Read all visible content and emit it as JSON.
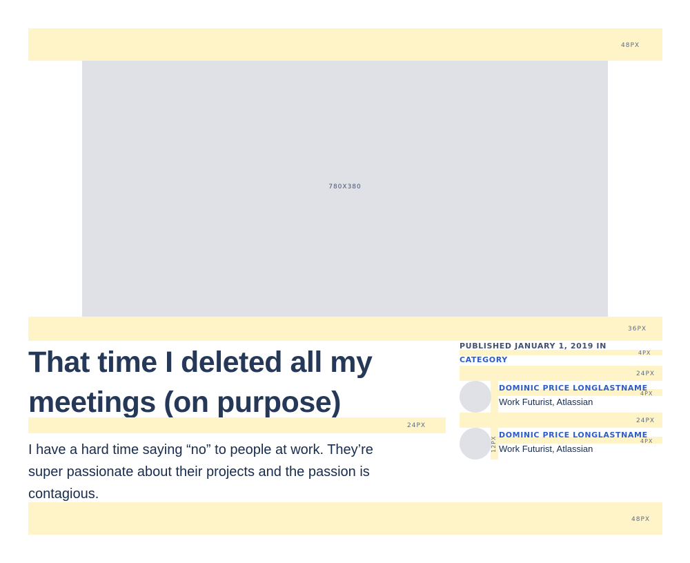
{
  "spacing": {
    "top": "48PX",
    "below_hero": "36PX",
    "below_title": "24PX",
    "meta_gap": "4PX",
    "below_meta": "24PX",
    "author_name_gap_1": "4PX",
    "between_authors": "24PX",
    "author_name_gap_2": "4PX",
    "avatar_gap": "12PX",
    "bottom": "48PX"
  },
  "hero": {
    "size_label": "780X380"
  },
  "article": {
    "title": "That time I deleted all my meetings (on purpose)",
    "intro": "I have a hard time saying “no” to people at work. They’re super passionate about their projects and the passion is contagious."
  },
  "meta": {
    "published": "PUBLISHED JANUARY 1, 2019 IN",
    "category": "CATEGORY"
  },
  "authors": [
    {
      "name": "DOMINIC PRICE LONGLASTNAME",
      "role": "Work Futurist, Atlassian"
    },
    {
      "name": "DOMINIC PRICE LONGLASTNAME",
      "role": "Work Futurist, Atlassian"
    }
  ],
  "colors": {
    "spacer": "#fff3c8",
    "placeholder": "#dfe1e6",
    "heading": "#253858",
    "link": "#2c5cc5"
  }
}
